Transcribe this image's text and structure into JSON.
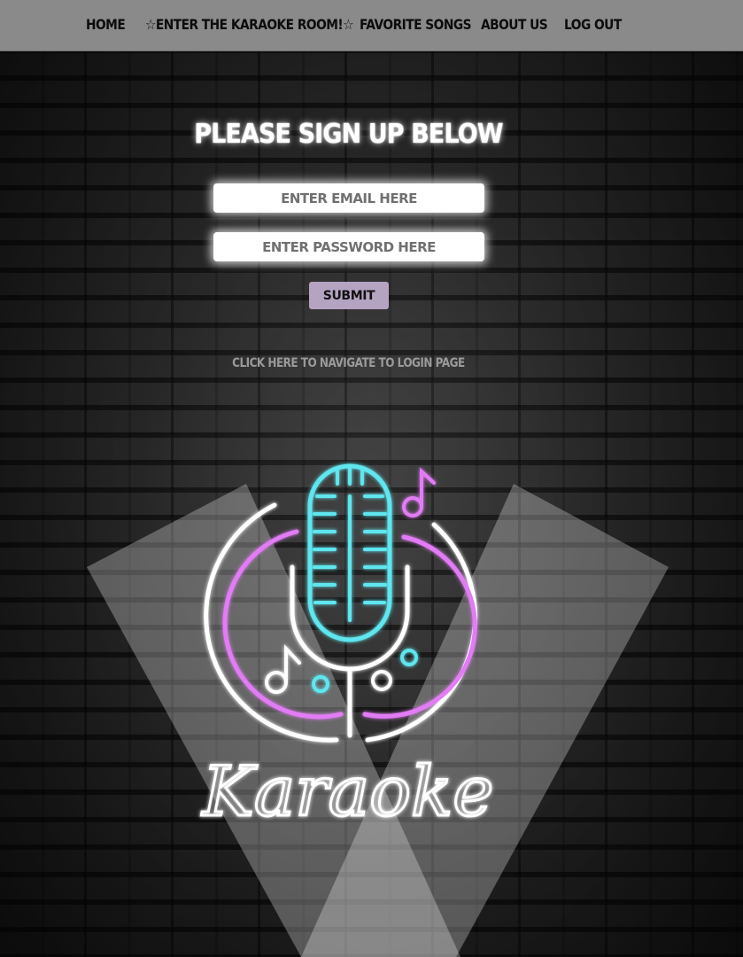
{
  "nav": {
    "items": [
      {
        "label": "Home"
      },
      {
        "label": "☆Enter the Karaoke Room!☆"
      },
      {
        "label": "Favorite Songs"
      },
      {
        "label": "About Us"
      },
      {
        "label": "Log Out"
      }
    ]
  },
  "signup": {
    "heading": "Please Sign Up Below",
    "email_placeholder": "ENTER EMAIL HERE",
    "password_placeholder": "ENTER PASSWORD HERE",
    "submit_label": "Submit",
    "login_link": "Click here to navigate to login page"
  },
  "logo": {
    "text": "Karaoke",
    "icon": "neon-microphone-icon"
  },
  "colors": {
    "nav_bg": "#8a8a8a",
    "submit_bg": "#b5a3c2",
    "neon_cyan": "#5ee6ee",
    "neon_pink": "#e27cf5",
    "neon_white": "#ffffff"
  }
}
